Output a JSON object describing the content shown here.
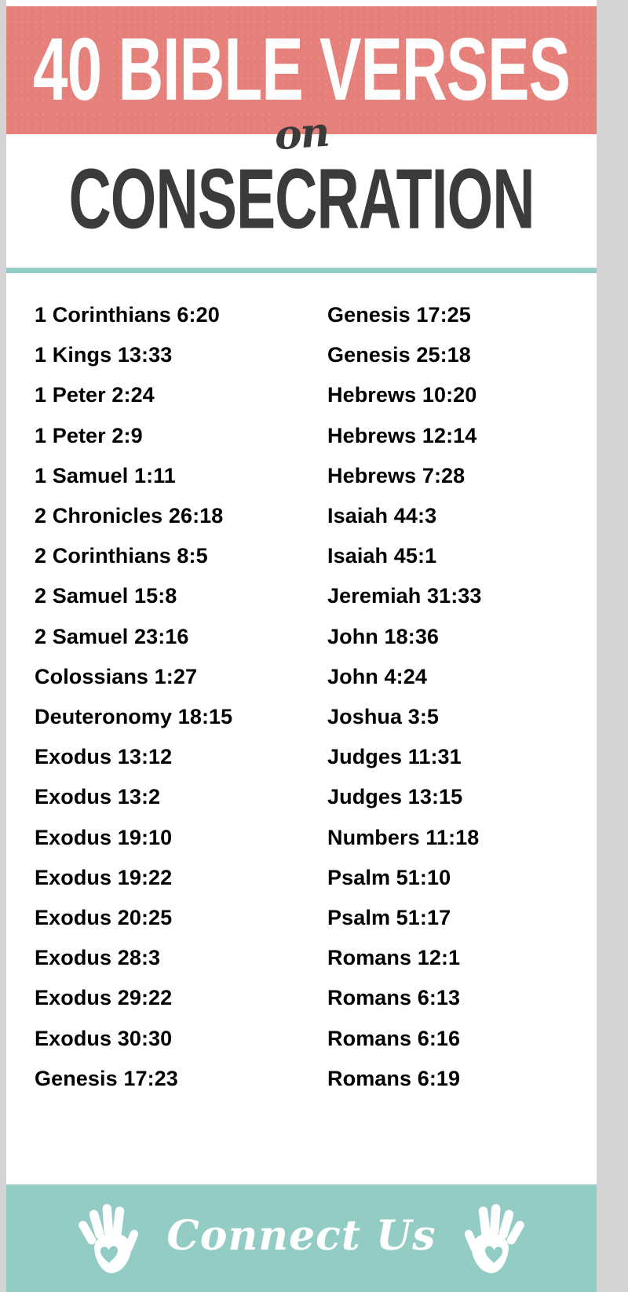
{
  "poster": {
    "count_title": "40 BIBLE VERSES",
    "connector": "on",
    "subject": "CONSECRATION",
    "colors": {
      "banner_red": "#e5817a",
      "accent_teal": "#92ccc4",
      "dark_text": "#3d3a3c",
      "page_border": "#d4d4d4"
    }
  },
  "verses": {
    "left_column": [
      "1 Corinthians 6:20",
      "1 Kings 13:33",
      "1 Peter 2:24",
      "1 Peter 2:9",
      "1 Samuel 1:11",
      "2 Chronicles 26:18",
      "2 Corinthians 8:5",
      "2 Samuel 15:8",
      "2 Samuel 23:16",
      "Colossians 1:27",
      "Deuteronomy 18:15",
      "Exodus 13:12",
      "Exodus 13:2",
      "Exodus 19:10",
      "Exodus 19:22",
      "Exodus 20:25",
      "Exodus 28:3",
      "Exodus 29:22",
      "Exodus 30:30",
      "Genesis 17:23"
    ],
    "right_column": [
      "Genesis 17:25",
      "Genesis 25:18",
      "Hebrews 10:20",
      "Hebrews 12:14",
      "Hebrews 7:28",
      "Isaiah 44:3",
      "Isaiah 45:1",
      "Jeremiah 31:33",
      "John 18:36",
      "John 4:24",
      "Joshua 3:5",
      "Judges 11:31",
      "Judges 13:15",
      "Numbers 11:18",
      "Psalm 51:10",
      "Psalm 51:17",
      "Romans 12:1",
      "Romans 6:13",
      "Romans 6:16",
      "Romans 6:19"
    ]
  },
  "footer": {
    "brand": "Connect Us",
    "left_icon": "handprint-icon",
    "right_icon": "handprint-icon"
  }
}
